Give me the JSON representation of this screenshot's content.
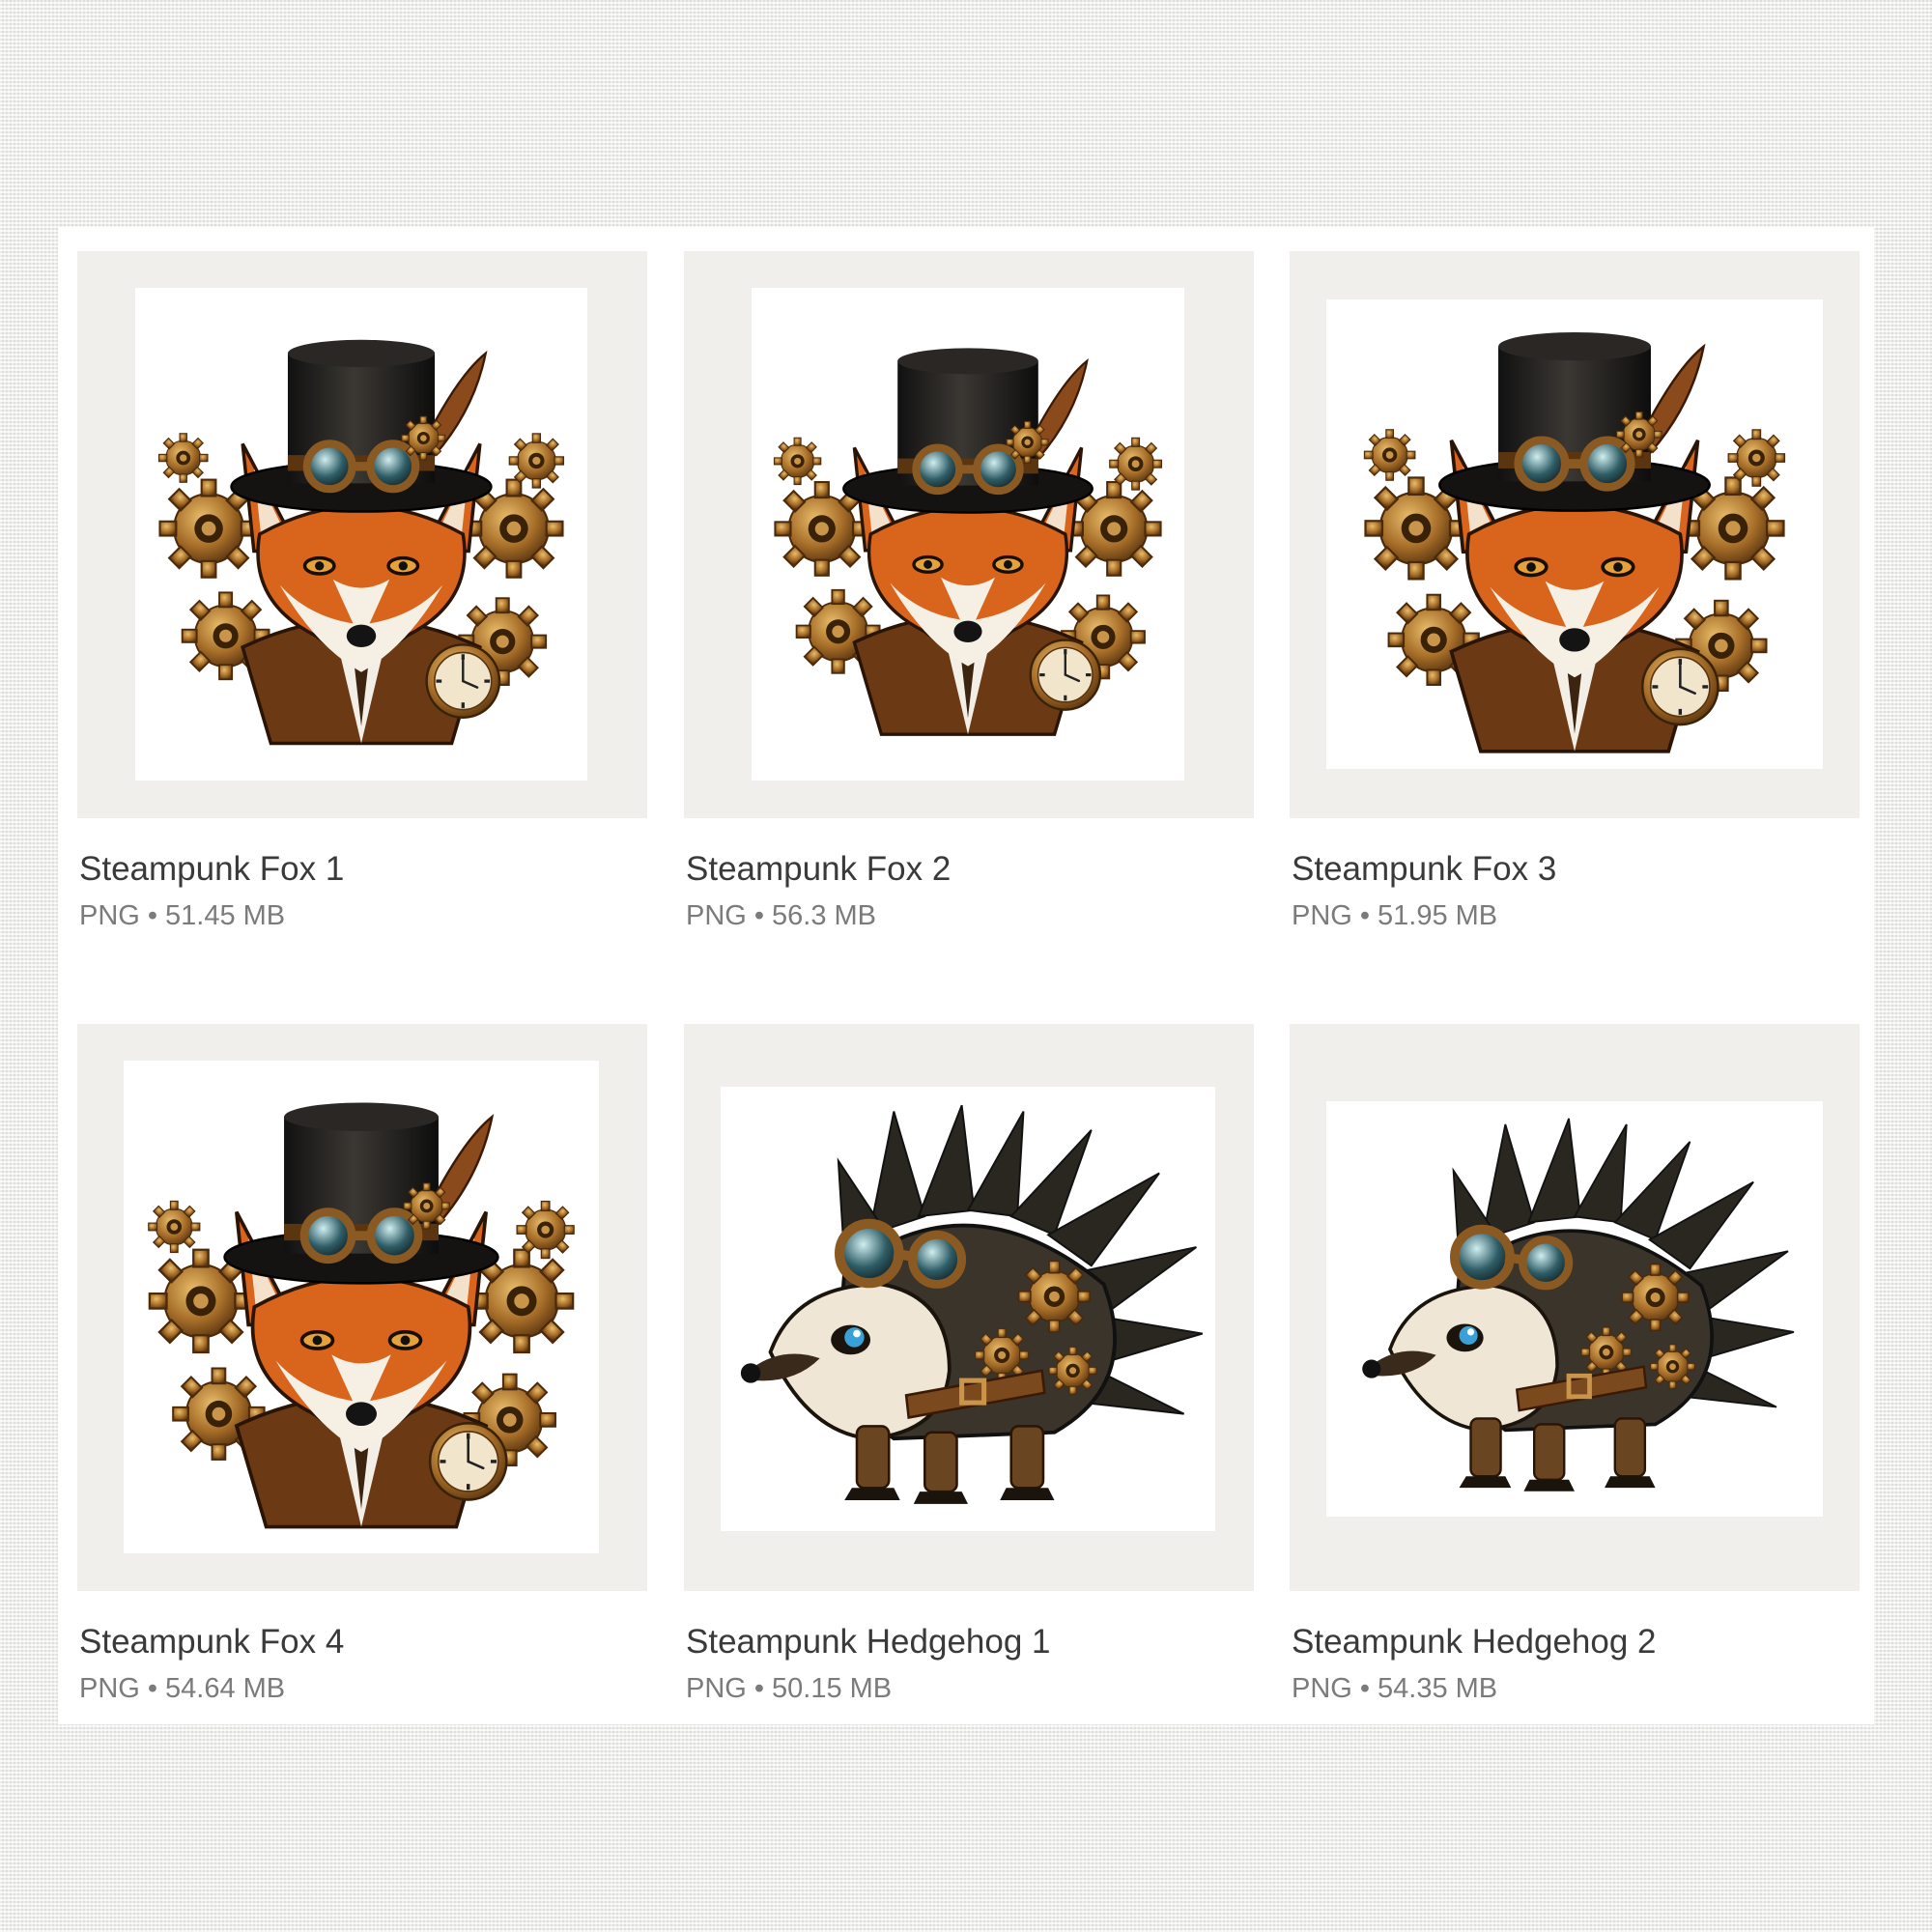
{
  "colors": {
    "page_bg": "#eeeeec",
    "panel_bg": "#ffffff",
    "thumb_bg": "#f1efec",
    "title_text": "#3a3a3a",
    "meta_text": "#7b7b7b",
    "fox_fur": "#d9641c",
    "brass": "#b07a33",
    "hat": "#1c1a18"
  },
  "separator": "•",
  "products": [
    {
      "title": "Steampunk Fox 1",
      "format": "PNG",
      "size": "51.45 MB",
      "icon": "steampunk-fox-image"
    },
    {
      "title": "Steampunk Fox 2",
      "format": "PNG",
      "size": "56.3 MB",
      "icon": "steampunk-fox-image"
    },
    {
      "title": "Steampunk Fox 3",
      "format": "PNG",
      "size": "51.95 MB",
      "icon": "steampunk-fox-image"
    },
    {
      "title": "Steampunk Fox 4",
      "format": "PNG",
      "size": "54.64 MB",
      "icon": "steampunk-fox-image"
    },
    {
      "title": "Steampunk Hedgehog 1",
      "format": "PNG",
      "size": "50.15 MB",
      "icon": "steampunk-hedgehog-image"
    },
    {
      "title": "Steampunk Hedgehog 2",
      "format": "PNG",
      "size": "54.35 MB",
      "icon": "steampunk-hedgehog-image"
    }
  ]
}
